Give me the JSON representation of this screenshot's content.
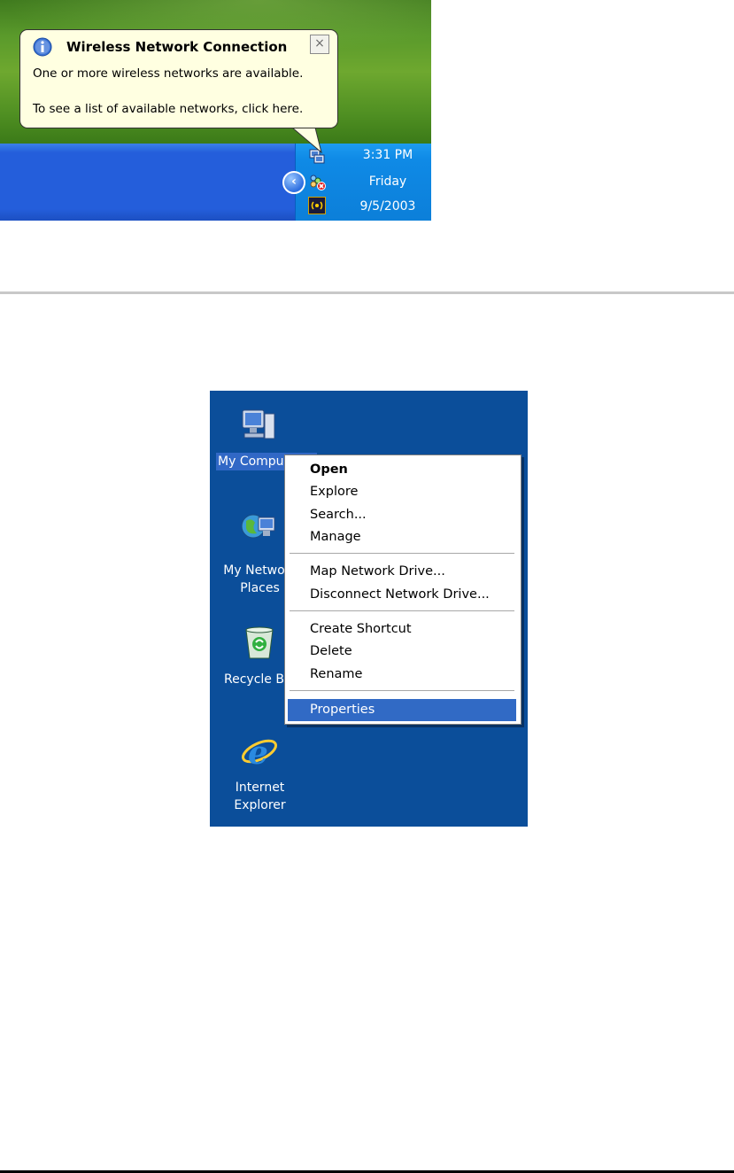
{
  "balloon": {
    "title": "Wireless Network Connection",
    "line1": "One or more wireless networks are available.",
    "line2": "To see a list of available networks, click here.",
    "close_glyph": "×",
    "icon": "info-icon"
  },
  "tray": {
    "time": "3:31 PM",
    "day": "Friday",
    "date": "9/5/2003",
    "expand_glyph": "‹",
    "icons": [
      "network-icon",
      "wireless-disconnected-icon",
      "wireless-signal-icon"
    ]
  },
  "desktop": {
    "icons": [
      {
        "name": "my-computer",
        "label": "My Compu",
        "icon": "computer-icon"
      },
      {
        "name": "my-network-places",
        "label_line1": "My Netwo",
        "label_line2": "Places",
        "icon": "network-globe-icon"
      },
      {
        "name": "recycle-bin",
        "label": "Recycle B",
        "icon": "recycle-bin-icon"
      },
      {
        "name": "internet-explorer",
        "label_line1": "Internet",
        "label_line2": "Explorer",
        "icon": "internet-explorer-icon"
      }
    ]
  },
  "context_menu": {
    "items": [
      {
        "label": "Open",
        "bold": true
      },
      {
        "label": "Explore"
      },
      {
        "label": "Search..."
      },
      {
        "label": "Manage"
      },
      {
        "label": "Map Network Drive..."
      },
      {
        "label": "Disconnect Network Drive..."
      },
      {
        "label": "Create Shortcut"
      },
      {
        "label": "Delete"
      },
      {
        "label": "Rename"
      },
      {
        "label": "Properties",
        "selected": true
      }
    ],
    "highlight_color": "#316ac5"
  },
  "colors": {
    "taskbar": "#245edb",
    "tray": "#0c7fd9",
    "desktop": "#0b4e9a",
    "balloon": "#ffffe1"
  }
}
